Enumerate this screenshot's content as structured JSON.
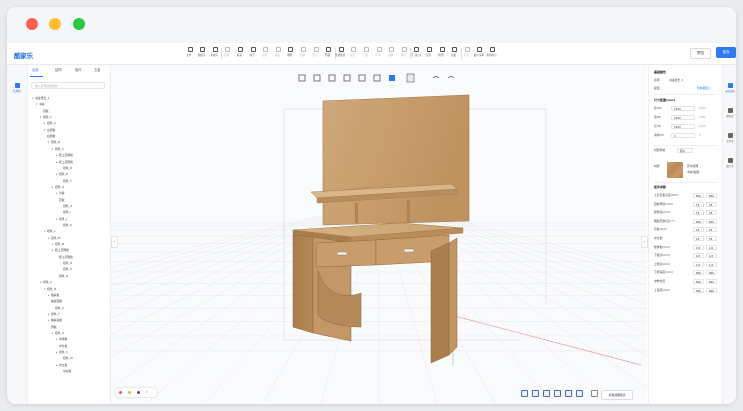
{
  "app": {
    "logo": "酷家乐"
  },
  "header": {
    "tools": [
      {
        "label": "文件",
        "dim": false
      },
      {
        "label": "模板库",
        "dim": false
      },
      {
        "label": "素材库",
        "dim": false
      },
      {
        "label": "撤销",
        "dim": true
      },
      {
        "label": "恢复",
        "dim": false
      },
      {
        "label": "清空",
        "dim": false
      },
      {
        "label": "复制",
        "dim": true
      },
      {
        "label": "粘贴",
        "dim": true
      },
      {
        "label": "删除",
        "dim": false
      },
      {
        "label": "隐藏",
        "dim": true
      },
      {
        "label": "显示",
        "dim": true
      },
      {
        "label": "测量",
        "dim": false
      },
      {
        "label": "生成板件",
        "dim": false
      },
      {
        "label": "组合",
        "dim": true
      },
      {
        "label": "打散",
        "dim": true
      },
      {
        "label": "阵列",
        "dim": true
      },
      {
        "label": "镜像",
        "dim": true
      },
      {
        "label": "排列",
        "dim": true
      },
      {
        "label": "尺寸标注",
        "dim": false
      },
      {
        "label": "渲染",
        "dim": false
      },
      {
        "label": "检测",
        "dim": false
      },
      {
        "label": "设置",
        "dim": false
      },
      {
        "label": "导出",
        "dim": true
      },
      {
        "label": "报价清单",
        "dim": false
      },
      {
        "label": "帮助中心",
        "dim": false
      }
    ],
    "preview_label": "预览",
    "save_label": "保存"
  },
  "left_rail": {
    "active_label": "结构树"
  },
  "tree": {
    "tabs": [
      "全部",
      "结构",
      "板件",
      "五金"
    ],
    "search_placeholder": "输入名称搜索结构",
    "nodes": [
      {
        "t": "▾",
        "label": "书桌组合_1",
        "i": 0
      },
      {
        "t": "▾",
        "label": "书桌",
        "i": 1
      },
      {
        "t": "",
        "label": "顶板",
        "i": 2
      },
      {
        "t": "▾",
        "label": "组件_1",
        "i": 2
      },
      {
        "t": "▸",
        "label": "组件_A",
        "i": 3
      },
      {
        "t": "▾",
        "label": "左侧板",
        "i": 3
      },
      {
        "t": "",
        "label": "右侧板",
        "i": 3
      },
      {
        "t": "▾",
        "label": "组件_B",
        "i": 4
      },
      {
        "t": "▾",
        "label": "组件_C",
        "i": 5
      },
      {
        "t": "▸",
        "label": "柜上层隔板",
        "i": 6
      },
      {
        "t": "▸",
        "label": "柜上层隔板",
        "i": 6
      },
      {
        "t": "",
        "label": "组件_D",
        "i": 7
      },
      {
        "t": "▸",
        "label": "组件_E",
        "i": 6
      },
      {
        "t": "",
        "label": "组件_F",
        "i": 7
      },
      {
        "t": "▸",
        "label": "组件_G",
        "i": 5
      },
      {
        "t": "▸",
        "label": "背板",
        "i": 6
      },
      {
        "t": "",
        "label": "层板",
        "i": 6
      },
      {
        "t": "",
        "label": "组件_H",
        "i": 7
      },
      {
        "t": "",
        "label": "组件_I",
        "i": 7
      },
      {
        "t": "▸",
        "label": "组件_J",
        "i": 6
      },
      {
        "t": "",
        "label": "组件_K",
        "i": 7
      },
      {
        "t": "▾",
        "label": "组件_L",
        "i": 3
      },
      {
        "t": "▸",
        "label": "组件_M",
        "i": 4
      },
      {
        "t": "▸",
        "label": "组件_N",
        "i": 5
      },
      {
        "t": "▸",
        "label": "柜上层隔板",
        "i": 5
      },
      {
        "t": "",
        "label": "柜上层隔板",
        "i": 6
      },
      {
        "t": "",
        "label": "组件_O",
        "i": 7
      },
      {
        "t": "",
        "label": "组件_P",
        "i": 7
      },
      {
        "t": "",
        "label": "组件_Q",
        "i": 6
      },
      {
        "t": "▾",
        "label": "组件_2",
        "i": 2
      },
      {
        "t": "▾",
        "label": "组件_R",
        "i": 3
      },
      {
        "t": "▸",
        "label": "抽屉板",
        "i": 4
      },
      {
        "t": "",
        "label": "抽屉面板",
        "i": 4
      },
      {
        "t": "",
        "label": "组件_S",
        "i": 5
      },
      {
        "t": "▸",
        "label": "组件_T",
        "i": 4
      },
      {
        "t": "▸",
        "label": "抽屉底板",
        "i": 4
      },
      {
        "t": "",
        "label": "侧板",
        "i": 4
      },
      {
        "t": "▸",
        "label": "组件_U",
        "i": 5
      },
      {
        "t": "▸",
        "label": "中侧板",
        "i": 6
      },
      {
        "t": "",
        "label": "中背板",
        "i": 6
      },
      {
        "t": "▸",
        "label": "组件_V",
        "i": 6
      },
      {
        "t": "",
        "label": "组件_W",
        "i": 7
      },
      {
        "t": "▸",
        "label": "中立板",
        "i": 6
      },
      {
        "t": "",
        "label": "中底板",
        "i": 7
      }
    ]
  },
  "viewport": {
    "colors": [
      "#e05a4f",
      "#f0b43c",
      "#5a5a5a"
    ],
    "bottom_select": "标准视图模式"
  },
  "props": {
    "section_title": "基础属性",
    "name_label": "名称",
    "name_value": "书桌组合_1",
    "model_label": "模型",
    "model_link": "替换模型 ▾",
    "size_title": "尺寸配置(mm)",
    "dims": [
      {
        "label": "宽(W)",
        "value": "1000",
        "unit": "1200"
      },
      {
        "label": "深(D)",
        "value": "1000",
        "unit": "1200"
      },
      {
        "label": "高(H)",
        "value": "1400",
        "unit": "1400"
      },
      {
        "label": "离地(H)",
        "value": "0",
        "unit": "0"
      }
    ],
    "style_label": "材质风格",
    "style_value": "原木",
    "material_label": "材质",
    "material_name": "原木纹理",
    "material_desc": "木纹/贴图",
    "param_title": "板件参数",
    "params": [
      {
        "label": "上层层板高度(mm)",
        "v1": "800",
        "v2": "800"
      },
      {
        "label": "顶板厚度(mm)",
        "v1": "18",
        "v2": "18"
      },
      {
        "label": "柜体深(mm)",
        "v1": "18",
        "v2": "18"
      },
      {
        "label": "搁板层数(层)(个)",
        "v1": "800",
        "v2": "800"
      },
      {
        "label": "背板(mm)",
        "v1": "18",
        "v2": "18"
      },
      {
        "label": "中立板",
        "v1": "18",
        "v2": "18"
      },
      {
        "label": "柜体板(mm)",
        "v1": "1/2",
        "v2": "1/2"
      },
      {
        "label": "下柜高(mm)",
        "v1": "1/2",
        "v2": "1/2"
      },
      {
        "label": "上柜高(mm)",
        "v1": "1/2",
        "v2": "1/2"
      },
      {
        "label": "下柜深度(mm)",
        "v1": "800",
        "v2": "800"
      },
      {
        "label": "中伸长度",
        "v1": "800",
        "v2": "800"
      },
      {
        "label": "上深度(mm)",
        "v1": "800",
        "v2": "800"
      }
    ]
  },
  "right_rail": {
    "items": [
      {
        "label": "属性面板",
        "active": true
      },
      {
        "label": "模型库",
        "active": false
      },
      {
        "label": "文件库",
        "active": false
      },
      {
        "label": "图片库",
        "active": false
      }
    ]
  }
}
